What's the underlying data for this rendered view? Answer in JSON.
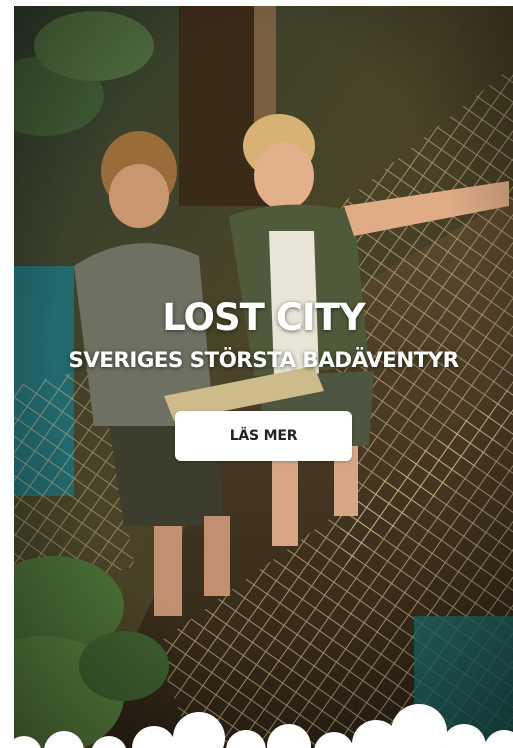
{
  "hero": {
    "title": "LOST CITY",
    "subtitle": "SVERIGES STÖRSTA BADÄVENTYR",
    "cta_label": "LÄS MER"
  },
  "colors": {
    "cta_background": "#ffffff",
    "cta_text": "#222222",
    "headline_text": "#ffffff"
  }
}
